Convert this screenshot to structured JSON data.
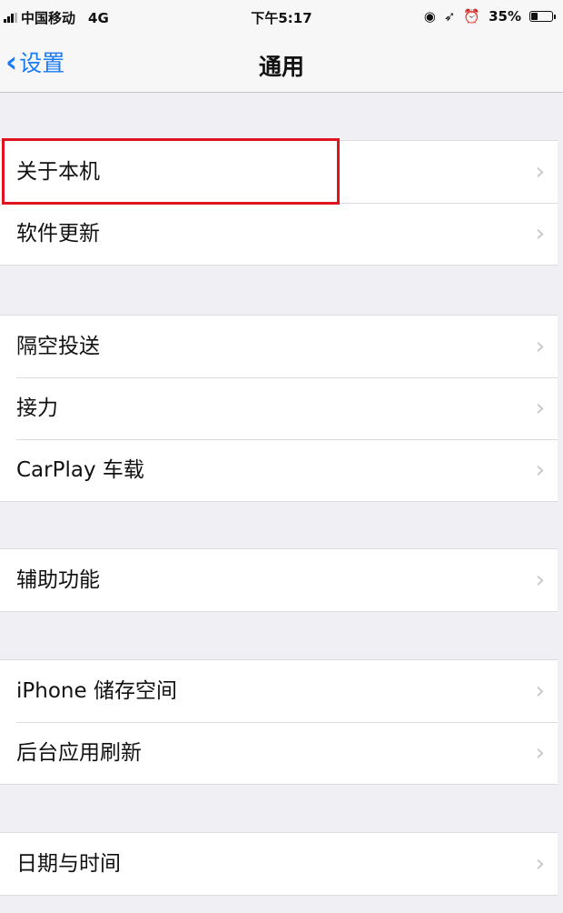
{
  "status_bar": {
    "carrier": "中国移动",
    "network": "4G",
    "time": "下午5:17",
    "battery": "35%",
    "battery_level": 0.35
  },
  "nav": {
    "back_label": "设置",
    "title": "通用"
  },
  "groups": [
    {
      "items": [
        {
          "label": "关于本机"
        },
        {
          "label": "软件更新"
        }
      ]
    },
    {
      "items": [
        {
          "label": "隔空投送"
        },
        {
          "label": "接力"
        },
        {
          "label": "CarPlay 车载"
        }
      ]
    },
    {
      "items": [
        {
          "label": "辅助功能"
        }
      ]
    },
    {
      "items": [
        {
          "label": "iPhone 储存空间"
        },
        {
          "label": "后台应用刷新"
        }
      ]
    },
    {
      "items": [
        {
          "label": "日期与时间"
        }
      ]
    }
  ],
  "colors": {
    "accent": "#1a7cf5",
    "highlight": "#e0141e",
    "background": "#efeff4"
  }
}
